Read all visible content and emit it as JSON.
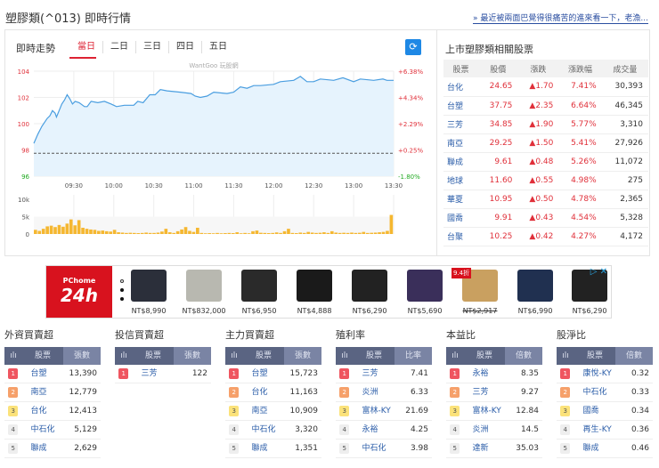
{
  "header": {
    "title": "塑膠類(^013) 即時行情",
    "link": "» 最近被兩面巴覺得很痛苦的進來看一下，老漁..."
  },
  "chart_panel": {
    "title": "即時走勢",
    "tabs": [
      "當日",
      "二日",
      "三日",
      "四日",
      "五日"
    ],
    "refresh_icon": "refresh-icon",
    "watermark": "WantGoo 玩股網"
  },
  "chart_data": {
    "type": "line",
    "x_ticks": [
      "09:30",
      "10:00",
      "10:30",
      "11:00",
      "11:30",
      "12:00",
      "12:30",
      "13:00",
      "13:30"
    ],
    "x_range_minutes": [
      0,
      270
    ],
    "ylim": [
      96,
      104
    ],
    "y_ticks": [
      "104",
      "102",
      "100",
      "98",
      "96"
    ],
    "y_right_ticks": [
      "+6.38%",
      "+4.34%",
      "+2.29%",
      "+0.25%",
      "-1.80%"
    ],
    "reference": 97.75,
    "price": [
      [
        0,
        98.5
      ],
      [
        3,
        99.2
      ],
      [
        6,
        99.8
      ],
      [
        10,
        100.4
      ],
      [
        12,
        100.6
      ],
      [
        14,
        101.0
      ],
      [
        16,
        100.8
      ],
      [
        17,
        100.5
      ],
      [
        19,
        101.0
      ],
      [
        21,
        101.5
      ],
      [
        23,
        101.8
      ],
      [
        25,
        102.2
      ],
      [
        27,
        101.9
      ],
      [
        29,
        101.5
      ],
      [
        31,
        101.7
      ],
      [
        34,
        101.6
      ],
      [
        38,
        101.3
      ],
      [
        40,
        101.3
      ],
      [
        43,
        101.7
      ],
      [
        48,
        101.6
      ],
      [
        53,
        101.7
      ],
      [
        58,
        101.5
      ],
      [
        62,
        101.3
      ],
      [
        68,
        101.4
      ],
      [
        75,
        101.4
      ],
      [
        78,
        101.7
      ],
      [
        82,
        101.6
      ],
      [
        87,
        102.2
      ],
      [
        91,
        102.2
      ],
      [
        95,
        102.6
      ],
      [
        100,
        102.5
      ],
      [
        110,
        102.4
      ],
      [
        118,
        102.3
      ],
      [
        121,
        102.1
      ],
      [
        125,
        102.0
      ],
      [
        130,
        102.1
      ],
      [
        135,
        102.4
      ],
      [
        145,
        102.3
      ],
      [
        150,
        102.4
      ],
      [
        155,
        102.8
      ],
      [
        160,
        102.7
      ],
      [
        165,
        102.9
      ],
      [
        170,
        102.9
      ],
      [
        180,
        103.0
      ],
      [
        185,
        103.2
      ],
      [
        195,
        103.3
      ],
      [
        200,
        103.6
      ],
      [
        205,
        103.2
      ],
      [
        210,
        103.2
      ],
      [
        215,
        103.4
      ],
      [
        225,
        103.3
      ],
      [
        232,
        103.5
      ],
      [
        240,
        103.2
      ],
      [
        245,
        103.4
      ],
      [
        255,
        103.3
      ],
      [
        262,
        103.4
      ],
      [
        265,
        103.3
      ],
      [
        270,
        103.3
      ]
    ],
    "volume_ylim": [
      0,
      10000
    ],
    "volume_ticks": [
      "10k",
      "5k",
      "0"
    ],
    "volume": [
      1200,
      900,
      1500,
      2200,
      2400,
      2000,
      2600,
      2100,
      3000,
      4200,
      2500,
      4000,
      1800,
      1500,
      1300,
      1200,
      900,
      1000,
      800,
      700,
      1200,
      500,
      400,
      300,
      350,
      300,
      250,
      300,
      400,
      300,
      300,
      400,
      700,
      1500,
      500,
      300,
      800,
      1300,
      2000,
      900,
      600,
      1800,
      300,
      200,
      250,
      200,
      300,
      200,
      250,
      300,
      250,
      500,
      200,
      300,
      200,
      800,
      1000,
      350,
      300,
      250,
      300,
      450,
      300,
      800,
      1500,
      300,
      250,
      400,
      300,
      600,
      400,
      300,
      350,
      500,
      300,
      800,
      400,
      300,
      350,
      300,
      400,
      300,
      350,
      600,
      300,
      350,
      400,
      500,
      600,
      900,
      5500
    ]
  },
  "related": {
    "title": "上市塑膠類相關股票",
    "headers": [
      "股票",
      "股價",
      "漲跌",
      "漲跌幅",
      "成交量"
    ],
    "rows": [
      [
        "台化",
        "24.65",
        "▲1.70",
        "7.41%",
        "30,393"
      ],
      [
        "台塑",
        "37.75",
        "▲2.35",
        "6.64%",
        "46,345"
      ],
      [
        "三芳",
        "34.85",
        "▲1.90",
        "5.77%",
        "3,310"
      ],
      [
        "南亞",
        "29.25",
        "▲1.50",
        "5.41%",
        "27,926"
      ],
      [
        "聯成",
        "9.61",
        "▲0.48",
        "5.26%",
        "11,072"
      ],
      [
        "地球",
        "11.60",
        "▲0.55",
        "4.98%",
        "275"
      ],
      [
        "華夏",
        "10.95",
        "▲0.50",
        "4.78%",
        "2,365"
      ],
      [
        "國喬",
        "9.91",
        "▲0.43",
        "4.54%",
        "5,328"
      ],
      [
        "台聚",
        "10.25",
        "▲0.42",
        "4.27%",
        "4,172"
      ]
    ]
  },
  "ad": {
    "logo_top": "PChome",
    "logo_main": "24h",
    "badge": "9.4折",
    "prices": [
      "NT$8,990",
      "NT$832,000",
      "NT$6,950",
      "NT$4,888",
      "NT$6,290",
      "NT$5,690",
      "NT$2,917",
      "NT$6,990",
      "NT$6,290"
    ]
  },
  "rankings": [
    {
      "title": "外資買賣超",
      "icon": "ılı",
      "col1": "股票",
      "col2": "張數",
      "rows": [
        [
          "1",
          "台塑",
          "13,390"
        ],
        [
          "2",
          "南亞",
          "12,779"
        ],
        [
          "3",
          "台化",
          "12,413"
        ],
        [
          "4",
          "中石化",
          "5,129"
        ],
        [
          "5",
          "聯成",
          "2,629"
        ]
      ]
    },
    {
      "title": "投信買賣超",
      "icon": "ılı",
      "col1": "股票",
      "col2": "張數",
      "rows": [
        [
          "1",
          "三芳",
          "122"
        ]
      ]
    },
    {
      "title": "主力買賣超",
      "icon": "ılı",
      "col1": "股票",
      "col2": "張數",
      "rows": [
        [
          "1",
          "台塑",
          "15,723"
        ],
        [
          "2",
          "台化",
          "11,163"
        ],
        [
          "3",
          "南亞",
          "10,909"
        ],
        [
          "4",
          "中石化",
          "3,320"
        ],
        [
          "5",
          "聯成",
          "1,351"
        ]
      ]
    },
    {
      "title": "殖利率",
      "icon": "ılı",
      "col1": "股票",
      "col2": "比率",
      "rows": [
        [
          "1",
          "三芳",
          "7.41"
        ],
        [
          "2",
          "炎洲",
          "6.33"
        ],
        [
          "3",
          "富林-KY",
          "21.69"
        ],
        [
          "4",
          "永裕",
          "4.25"
        ],
        [
          "5",
          "中石化",
          "3.98"
        ]
      ]
    },
    {
      "title": "本益比",
      "icon": "ılı",
      "col1": "股票",
      "col2": "倍數",
      "rows": [
        [
          "1",
          "永裕",
          "8.35"
        ],
        [
          "2",
          "三芳",
          "9.27"
        ],
        [
          "3",
          "富林-KY",
          "12.84"
        ],
        [
          "4",
          "炎洲",
          "14.5"
        ],
        [
          "5",
          "達新",
          "35.03"
        ]
      ]
    },
    {
      "title": "股淨比",
      "icon": "ılı",
      "col1": "股票",
      "col2": "倍數",
      "rows": [
        [
          "1",
          "康悅-KY",
          "0.32"
        ],
        [
          "2",
          "中石化",
          "0.33"
        ],
        [
          "3",
          "國喬",
          "0.34"
        ],
        [
          "4",
          "再生-KY",
          "0.36"
        ],
        [
          "5",
          "聯成",
          "0.46"
        ]
      ]
    }
  ]
}
